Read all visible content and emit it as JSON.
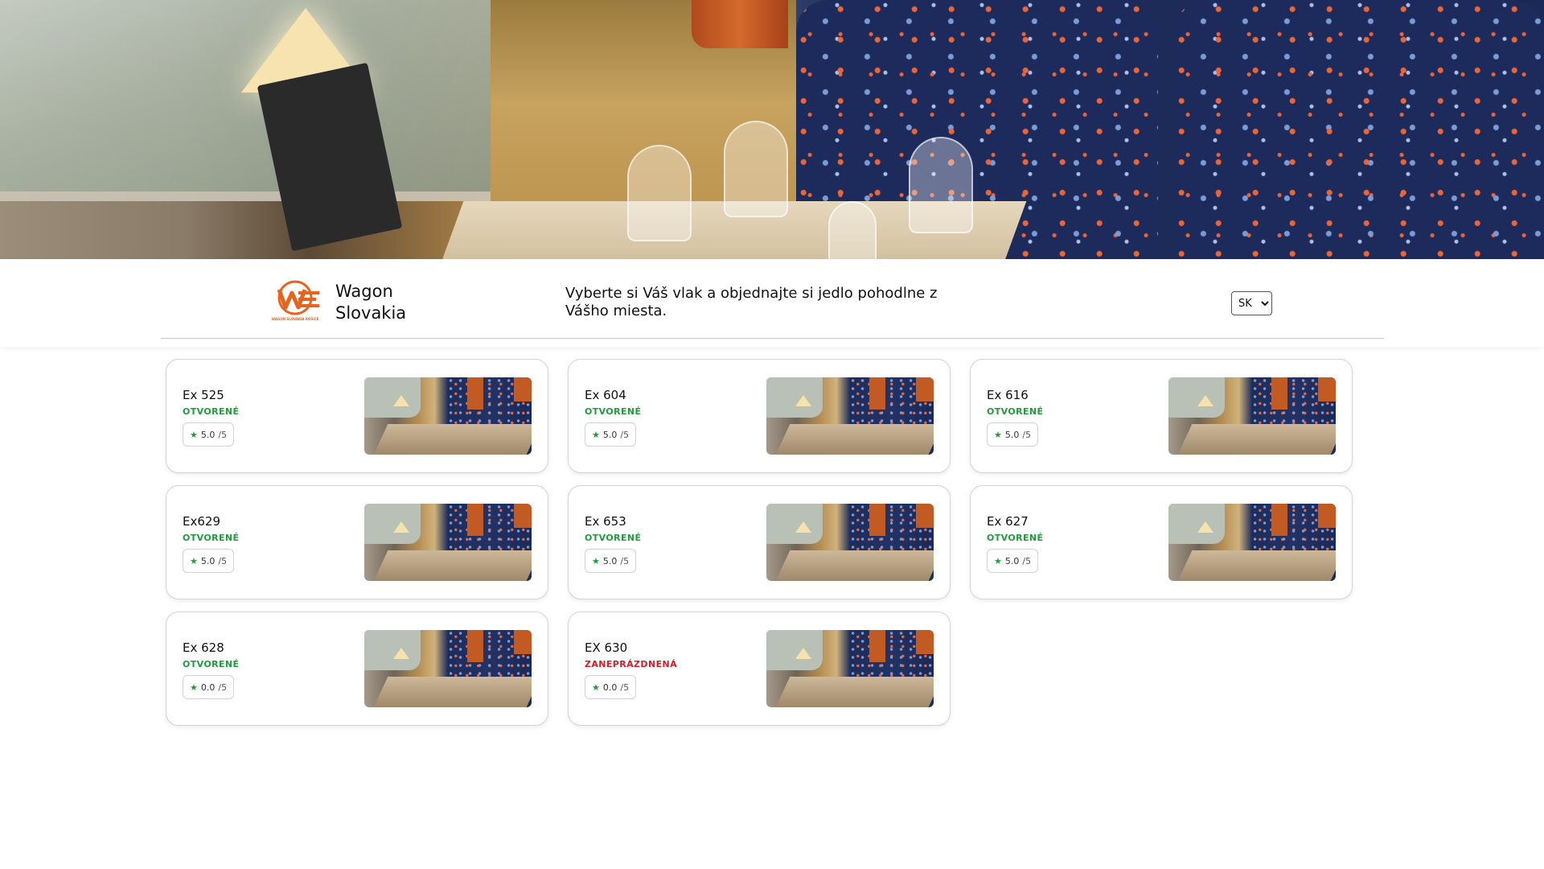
{
  "header": {
    "brand": "Wagon Slovakia",
    "tagline": "Vyberte si Váš vlak a objednajte si jedlo pohodlne z Vášho miesta.",
    "logo_icon": "wagon-slovakia-logo",
    "logo_text": "WAGON SLOVAKIA KOŠICE",
    "language": {
      "selected": "SK",
      "options": [
        "SK"
      ]
    }
  },
  "colors": {
    "open": "#1f9d3a",
    "busy": "#d21f2b",
    "accent": "#e8641e"
  },
  "trains": [
    {
      "name": "Ex 525",
      "status": "OTVORENÉ",
      "rating": "5.0",
      "scale": "/5"
    },
    {
      "name": "Ex 604",
      "status": "OTVORENÉ",
      "rating": "5.0",
      "scale": "/5"
    },
    {
      "name": "Ex 616",
      "status": "OTVORENÉ",
      "rating": "5.0",
      "scale": "/5"
    },
    {
      "name": "Ex629",
      "status": "OTVORENÉ",
      "rating": "5.0",
      "scale": "/5"
    },
    {
      "name": "Ex 653",
      "status": "OTVORENÉ",
      "rating": "5.0",
      "scale": "/5"
    },
    {
      "name": "Ex 627",
      "status": "OTVORENÉ",
      "rating": "5.0",
      "scale": "/5"
    },
    {
      "name": "Ex 628",
      "status": "OTVORENÉ",
      "rating": "0.0",
      "scale": "/5"
    },
    {
      "name": "EX 630",
      "status": "ZANEPRÁZDNENÁ",
      "rating": "0.0",
      "scale": "/5"
    }
  ]
}
